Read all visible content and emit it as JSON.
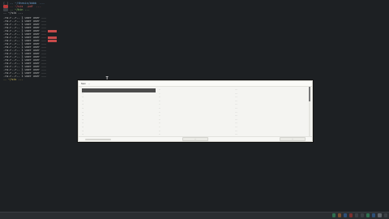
{
  "terminal": {
    "lines": [
      {
        "prefix": "[ ]",
        "tag": "",
        "text": "-- ~/thesis/bbbb  ..."
      },
      {
        "prefix": "",
        "tag": "red",
        "text": "-- ~/sis  .pdf  ..."
      },
      {
        "prefix": "",
        "tag": "dark",
        "text": "-- ~/bin ..."
      },
      {
        "prefix": "",
        "tag": "",
        "text": "-- ~/sis ..."
      },
      {
        "prefix": "",
        "tag": "",
        "text": "-rw-r--r-- 1 user user ..."
      },
      {
        "prefix": "",
        "tag": "",
        "text": "-rw-r--r-- 1 user user ..."
      },
      {
        "prefix": "",
        "tag": "",
        "text": "-rw-r--r-- 1 user user ..."
      },
      {
        "prefix": "",
        "tag": "",
        "text": "-rw-r--r-- 1 user user ..."
      },
      {
        "prefix": "",
        "tag": "",
        "text": "-rw-r--r-- 1 user user ..."
      },
      {
        "prefix": "",
        "tag": "",
        "text": "-rw-r--r-- 1 user user ..."
      },
      {
        "prefix": "",
        "tag": "",
        "text": "-rw-r--r-- 1 user user ..."
      },
      {
        "prefix": "",
        "tag": "",
        "text": "-rw-r--r-- 1 user user ..."
      },
      {
        "prefix": "",
        "tag": "",
        "text": "-rw-r--r-- 1 user user ..."
      },
      {
        "prefix": "",
        "tag": "",
        "text": "-rw-r--r-- 1 user user ..."
      },
      {
        "prefix": "",
        "tag": "",
        "text": "-rw-r--r-- 1 user user ..."
      },
      {
        "prefix": "",
        "tag": "",
        "text": "-rw-r--r-- 1 user user ..."
      },
      {
        "prefix": "",
        "tag": "",
        "text": "-rw-r--r-- 1 user user ..."
      },
      {
        "prefix": "",
        "tag": "",
        "text": "-rw-r--r-- 1 user user ..."
      },
      {
        "prefix": "",
        "tag": "",
        "text": "-rw-r--r-- 1 user user ..."
      },
      {
        "prefix": "",
        "tag": "",
        "text": "-rw-r--r-- 1 user user ..."
      },
      {
        "prefix": "",
        "tag": "",
        "text": "-rw-r--r-- 1 user user ..."
      },
      {
        "prefix": "",
        "tag": "",
        "text": "-rw-r--r-- 1 user user ..."
      },
      {
        "prefix": "",
        "tag": "",
        "text": "-rw-r--r-- 1 user user ..."
      },
      {
        "prefix": "",
        "tag": "",
        "text": "-- ~/sis ..."
      }
    ],
    "cursor": "I"
  },
  "dialog": {
    "header_left": [
      "Nam",
      "..."
    ],
    "header_right": [
      "",
      "",
      ""
    ],
    "rows": [
      [
        "",
        "...",
        "..."
      ],
      [
        "...",
        "...",
        "..."
      ],
      [
        "...",
        "...",
        "..."
      ],
      [
        "...",
        "...",
        "..."
      ],
      [
        "...",
        "...",
        "..."
      ],
      [
        "...",
        "...",
        "..."
      ],
      [
        "...",
        "...",
        "..."
      ],
      [
        "...",
        "...",
        "..."
      ],
      [
        "...",
        "...",
        "..."
      ],
      [
        "...",
        "...",
        "..."
      ],
      [
        "...",
        "...",
        "..."
      ],
      [
        "...",
        "...",
        "..."
      ],
      [
        "...",
        "...",
        "..."
      ],
      [
        "...",
        "...",
        "..."
      ]
    ],
    "buttons": [
      "",
      "...",
      "..."
    ]
  },
  "taskbar": {
    "items": [
      "",
      "",
      "",
      "",
      "",
      "",
      "",
      ""
    ],
    "clock": ""
  }
}
